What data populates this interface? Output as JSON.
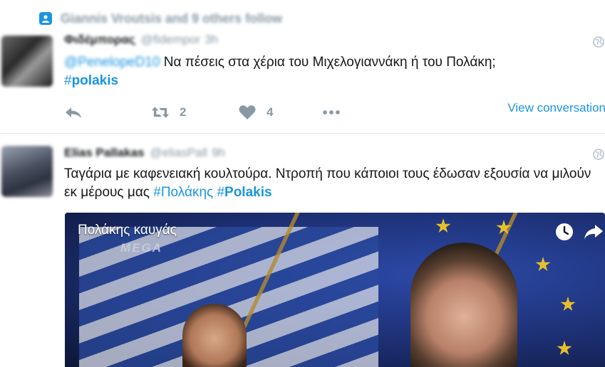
{
  "social_context": {
    "text": "Giannis Vroutsis and 9 others follow"
  },
  "tweets": [
    {
      "name": "Φιδέμπορας",
      "handle": "@fidempor",
      "time": "3h",
      "mention": "@PenelopeD10",
      "text": " Να πέσεις στα χέρια του Μιχελογιαννάκη ή του Πολάκη;",
      "hashtag_prefix": "#",
      "hashtag": "polakis",
      "retweets": "2",
      "likes": "4",
      "view_conversation": "View conversation"
    },
    {
      "name": "Elias Pallakas",
      "handle": "@eliasPall",
      "time": "9h",
      "text": "Ταγάρια με καφενειακή κουλτούρα. Ντροπή που κάποιοι τους έδωσαν εξουσία να μιλούν εκ μέρους μας ",
      "hashtag1": "#Πολάκης",
      "hashtag2_prefix": "#",
      "hashtag2": "Polakis",
      "video": {
        "title": "Πολάκης καυγάς",
        "logo": "MEGA"
      }
    }
  ],
  "colors": {
    "accent": "#1b95e0",
    "muted": "#8899a6",
    "divider": "#e1e8ed"
  },
  "icons": [
    "person-icon",
    "globe-icon",
    "reply-icon",
    "retweet-icon",
    "heart-icon",
    "more-icon",
    "clock-icon",
    "share-icon"
  ]
}
